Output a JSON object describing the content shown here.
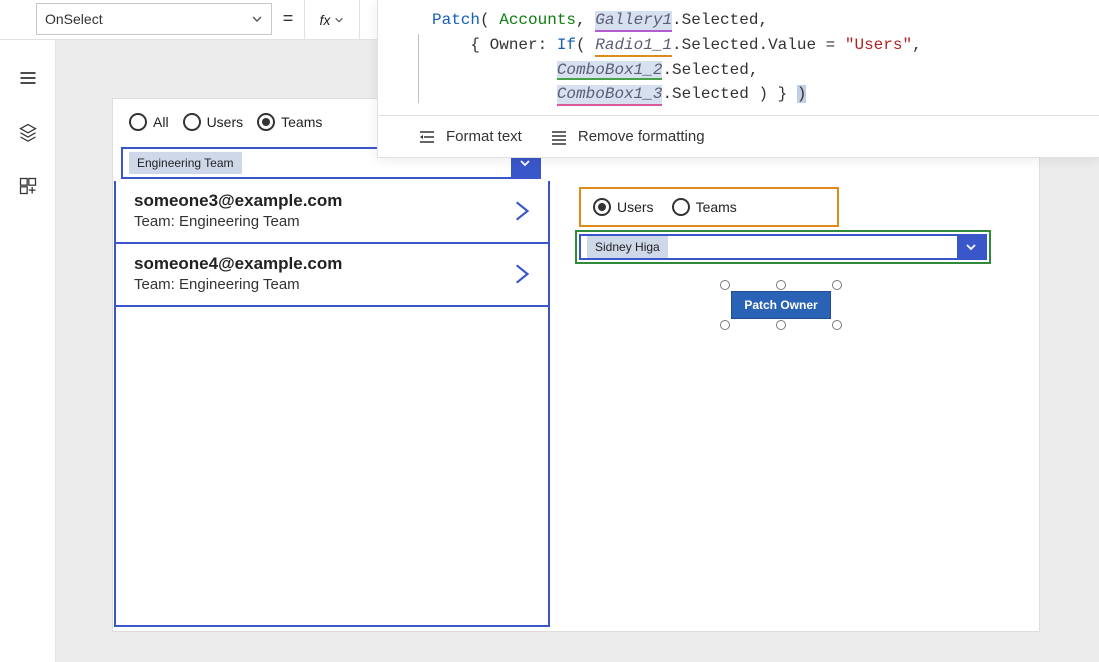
{
  "property": {
    "selected": "OnSelect"
  },
  "formula": {
    "fn_patch": "Patch",
    "ds_accounts": "Accounts",
    "var_gallery": "Gallery1",
    "dot_selected": ".Selected,",
    "prop_owner": "Owner: ",
    "fn_if": "If",
    "var_radio": "Radio1_1",
    "dot_selected_value_eq": ".Selected.Value = ",
    "str_users": "\"Users\"",
    "var_cb2": "ComboBox1_2",
    "var_cb3": "ComboBox1_3",
    "dot_selected2": ".Selected,",
    "dot_selected_close": ".Selected ) } "
  },
  "formula_toolbar": {
    "format": "Format text",
    "remove": "Remove formatting"
  },
  "icons": {
    "hamburger": "hamburger-icon",
    "layers": "layers-icon",
    "components": "components-icon"
  },
  "radios_left": {
    "all": "All",
    "users": "Users",
    "teams": "Teams",
    "selected": "Teams"
  },
  "combo_teams": {
    "value": "Engineering Team"
  },
  "gallery": [
    {
      "title": "someone3@example.com",
      "subtitle": "Team: Engineering Team"
    },
    {
      "title": "someone4@example.com",
      "subtitle": "Team: Engineering Team"
    }
  ],
  "radios_right": {
    "users": "Users",
    "teams": "Teams",
    "selected": "Users"
  },
  "combo_users": {
    "value": "Sidney Higa"
  },
  "button": {
    "patch_owner": "Patch Owner"
  }
}
